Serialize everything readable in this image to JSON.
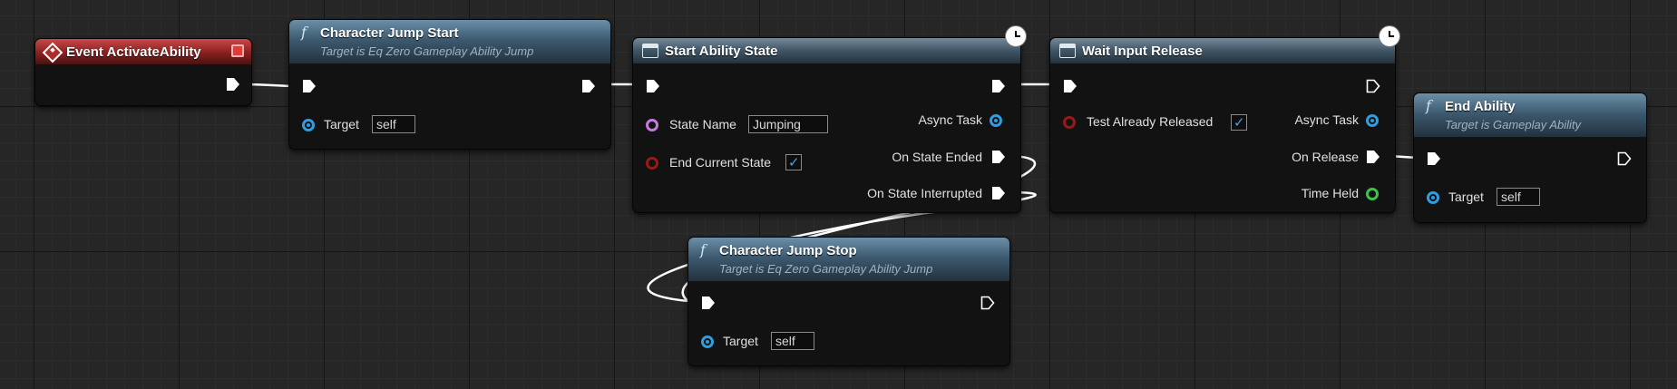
{
  "nodes": {
    "event_activate": {
      "title": "Event ActivateAbility"
    },
    "jump_start": {
      "title": "Character Jump Start",
      "subtitle": "Target is Eq Zero Gameplay Ability Jump",
      "target_label": "Target",
      "target_value": "self"
    },
    "start_ability_state": {
      "title": "Start Ability State",
      "state_name_label": "State Name",
      "state_name_value": "Jumping",
      "end_current_label": "End Current State",
      "end_current_checked": true,
      "async_task_label": "Async Task",
      "on_state_ended_label": "On State Ended",
      "on_state_interrupted_label": "On State Interrupted"
    },
    "wait_input_release": {
      "title": "Wait Input Release",
      "test_already_label": "Test Already Released",
      "test_already_checked": true,
      "async_task_label": "Async Task",
      "on_release_label": "On Release",
      "time_held_label": "Time Held"
    },
    "end_ability": {
      "title": "End Ability",
      "subtitle": "Target is Gameplay Ability",
      "target_label": "Target",
      "target_value": "self"
    },
    "jump_stop": {
      "title": "Character Jump Stop",
      "subtitle": "Target is Eq Zero Gameplay Ability Jump",
      "target_label": "Target",
      "target_value": "self"
    }
  },
  "icons": {
    "function": "f",
    "checkmark": "✓"
  },
  "colors": {
    "object_pin": "#2f9de0",
    "name_pin": "#c779e0",
    "bool_pin": "#9a1818",
    "float_pin": "#3cc24a",
    "exec_wire": "#ffffff",
    "event_header": "#8a1f1f",
    "function_header": "#3d5a70"
  }
}
